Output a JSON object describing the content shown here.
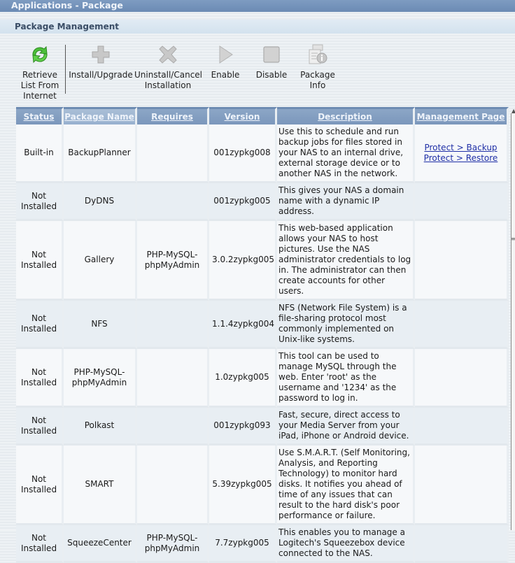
{
  "window": {
    "title": "Applications - Package"
  },
  "section": {
    "title": "Package Management"
  },
  "toolbar": [
    {
      "id": "retrieve",
      "label": "Retrieve\nList From\nInternet",
      "icon": "refresh-icon",
      "enabled": true
    },
    {
      "id": "install",
      "label": "Install/Upgrade",
      "icon": "plus-icon",
      "enabled": false
    },
    {
      "id": "uninstall",
      "label": "Uninstall/Cancel\nInstallation",
      "icon": "x-icon",
      "enabled": false
    },
    {
      "id": "enable",
      "label": "Enable",
      "icon": "play-icon",
      "enabled": false
    },
    {
      "id": "disable",
      "label": "Disable",
      "icon": "stop-icon",
      "enabled": false
    },
    {
      "id": "info",
      "label": "Package\nInfo",
      "icon": "info-icon",
      "enabled": false
    }
  ],
  "table": {
    "columns": [
      "Status",
      "Package Name",
      "Requires",
      "Version",
      "Description",
      "Management Page"
    ],
    "sorted_column": "Package Name",
    "rows": [
      {
        "status": "Built-in",
        "name": "BackupPlanner",
        "requires": "",
        "version": "001zypkg008",
        "description": "Use this to schedule and run backup jobs for files stored in your NAS to an internal drive, external storage device or to another NAS in the network.",
        "links": [
          "Protect > Backup",
          "Protect > Restore"
        ]
      },
      {
        "status": "Not Installed",
        "name": "DyDNS",
        "requires": "",
        "version": "001zypkg005",
        "description": "This gives your NAS a domain name with a dynamic IP address.",
        "links": []
      },
      {
        "status": "Not Installed",
        "name": "Gallery",
        "requires": "PHP-MySQL-phpMyAdmin",
        "version": "3.0.2zypkg005",
        "description": "This web-based application allows your NAS to host pictures. Use the NAS administrator credentials to log in. The administrator can then create accounts for other users.",
        "links": []
      },
      {
        "status": "Not Installed",
        "name": "NFS",
        "requires": "",
        "version": "1.1.4zypkg004",
        "description": "NFS (Network File System) is a file-sharing protocol most commonly implemented on Unix-like systems.",
        "links": []
      },
      {
        "status": "Not Installed",
        "name": "PHP-MySQL-phpMyAdmin",
        "requires": "",
        "version": "1.0zypkg005",
        "description": "This tool can be used to manage MySQL through the web. Enter 'root' as the username and '1234' as the password to log in.",
        "links": []
      },
      {
        "status": "Not Installed",
        "name": "Polkast",
        "requires": "",
        "version": "001zypkg093",
        "description": "Fast, secure, direct access to your Media Server from your iPad, iPhone or Android device.",
        "links": []
      },
      {
        "status": "Not Installed",
        "name": "SMART",
        "requires": "",
        "version": "5.39zypkg005",
        "description": "Use S.M.A.R.T. (Self Monitoring, Analysis, and Reporting Technology) to monitor hard disks. It notifies you ahead of time of any issues that can result to the hard disk's poor performance or failure.",
        "links": []
      },
      {
        "status": "Not Installed",
        "name": "SqueezeCenter",
        "requires": "PHP-MySQL-phpMyAdmin",
        "version": "7.7zypkg005",
        "description": "This enables you to manage a Logitech's Squeezebox device connected to the NAS.",
        "links": []
      }
    ]
  }
}
